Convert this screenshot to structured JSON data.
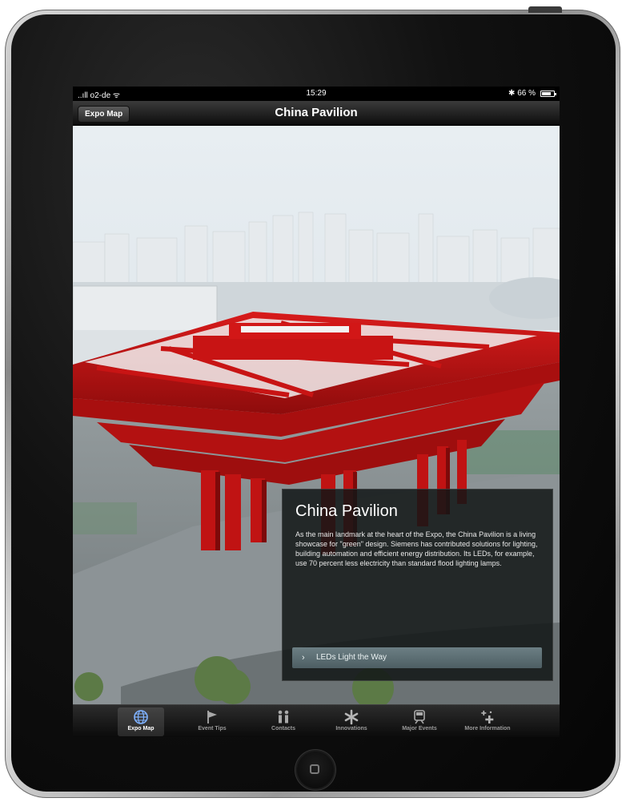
{
  "status_bar": {
    "carrier": "..ıll o2-de ᯤ",
    "time": "15:29",
    "battery": "✱ 66 %"
  },
  "nav_bar": {
    "back_label": "Expo Map",
    "title": "China Pavilion"
  },
  "info_panel": {
    "title": "China Pavilion",
    "body": "As the main landmark at the heart of the Expo, the China Pavilion is a living showcase for \"green\" design. Siemens has contributed solutions for lighting, building automation and efficient energy distribution. Its LEDs, for example, use 70 percent less electricity than standard flood lighting lamps.",
    "link_label": "LEDs Light the Way",
    "link_chevron": "›"
  },
  "tab_bar": {
    "tabs": [
      {
        "label": "Expo Map",
        "icon": "globe-icon",
        "selected": true
      },
      {
        "label": "Event Tips",
        "icon": "flag-icon",
        "selected": false
      },
      {
        "label": "Contacts",
        "icon": "contacts-icon",
        "selected": false
      },
      {
        "label": "Innovations",
        "icon": "asterisk-icon",
        "selected": false
      },
      {
        "label": "Major Events",
        "icon": "train-icon",
        "selected": false
      },
      {
        "label": "More Information",
        "icon": "sparkle-icon",
        "selected": false
      }
    ]
  },
  "colors": {
    "pavilion_red": "#c81414",
    "sky": "#dfe8ee",
    "panel_link": "#5e7075"
  }
}
